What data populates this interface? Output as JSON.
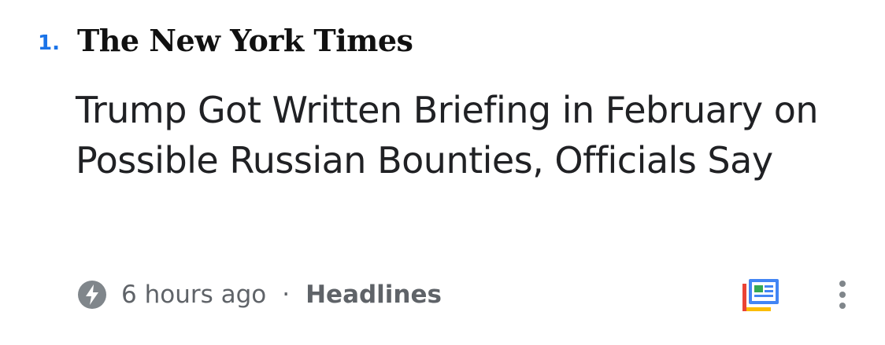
{
  "article": {
    "rank": "1.",
    "source": "The New York Times",
    "headline": "Trump Got Written Briefing in February on Possible Russian Bounties, Officials Say",
    "time_ago": "6 hours ago",
    "separator": "·",
    "section": "Headlines"
  },
  "icons": {
    "meta": "amp-bolt-icon",
    "newsstand": "newsstand-icon",
    "more": "more-vert-icon"
  },
  "colors": {
    "rank": "#1a73e8",
    "headline": "#202124",
    "meta": "#5f6368",
    "icon_gray": "#80868b",
    "google_blue": "#4285f4",
    "google_red": "#ea4335",
    "google_yellow": "#fbbc04",
    "google_green": "#34a853"
  }
}
